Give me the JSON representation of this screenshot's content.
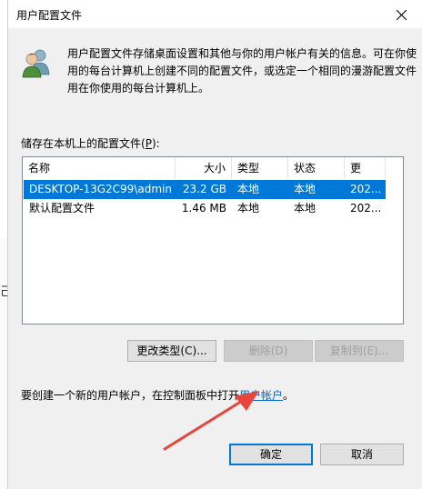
{
  "background": {
    "partial_glyph": "己"
  },
  "dialog": {
    "title": "用户配置文件",
    "description": "用户配置文件存储桌面设置和其他与你的用户帐户有关的信息。可在你使用的每台计算机上创建不同的配置文件，或选定一个相同的漫游配置文件用在你使用的每台计算机上。",
    "list_label_prefix": "储存在本机上的配置文件(",
    "list_label_key": "P",
    "list_label_suffix": "):",
    "columns": [
      "名称",
      "大小",
      "类型",
      "状态",
      "更改..."
    ],
    "profiles": [
      {
        "name": "DESKTOP-13G2C99\\admin",
        "size": "23.2 GB",
        "type": "本地",
        "status": "本地",
        "modified": "202...",
        "selected": true
      },
      {
        "name": "默认配置文件",
        "size": "1.46 MB",
        "type": "本地",
        "status": "本地",
        "modified": "202...",
        "selected": false
      }
    ],
    "buttons": {
      "change_type": "更改类型(C)...",
      "delete": "删除(D)",
      "copy_to": "复制到(E)...",
      "ok": "确定",
      "cancel": "取消"
    },
    "help_prefix": "要创建一个新的用户帐户，在控制面板中打开",
    "help_link": "用户帐户",
    "help_suffix": "。"
  },
  "colors": {
    "selection": "#0078d7",
    "link": "#0066cc",
    "arrow": "#e8453c"
  }
}
